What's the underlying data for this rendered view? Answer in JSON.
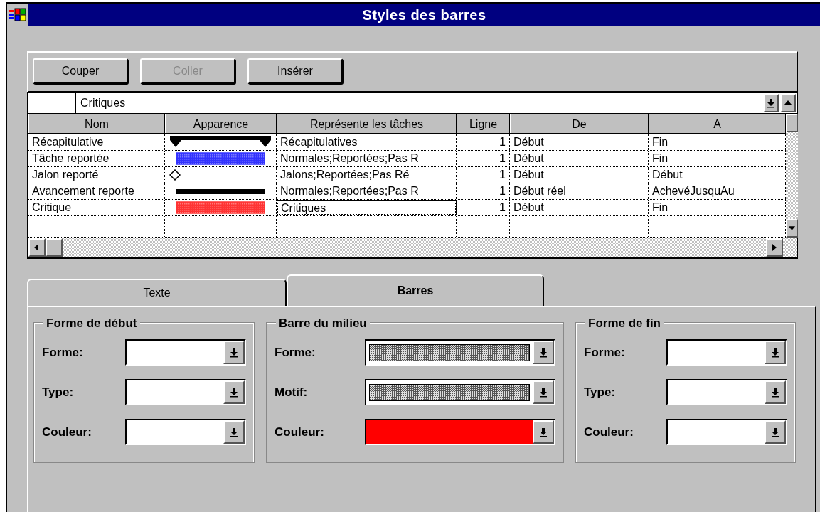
{
  "window": {
    "title": "Styles des barres"
  },
  "toolbar": {
    "buttons": [
      {
        "label": "Couper",
        "disabled": false
      },
      {
        "label": "Coller",
        "disabled": true
      },
      {
        "label": "Insérer",
        "disabled": false
      }
    ]
  },
  "edit_line": {
    "value": "Critiques"
  },
  "table": {
    "columns": [
      "Nom",
      "Apparence",
      "Représente les tâches",
      "Ligne",
      "De",
      "A"
    ],
    "rows": [
      {
        "name": "Récapitulative",
        "appearance": {
          "kind": "summary",
          "color": "#000000"
        },
        "tasks": "Récapitulatives",
        "line": "1",
        "from": "Début",
        "to": "Fin",
        "selected": false
      },
      {
        "name": "Tâche reportée",
        "appearance": {
          "kind": "bar",
          "color": "#3333ff"
        },
        "tasks": "Normales;Reportées;Pas R",
        "line": "1",
        "from": "Début",
        "to": "Fin",
        "selected": false
      },
      {
        "name": "Jalon reporté",
        "appearance": {
          "kind": "diamond",
          "color": "#000000"
        },
        "tasks": "Jalons;Reportées;Pas Ré",
        "line": "1",
        "from": "Début",
        "to": "Début",
        "selected": false
      },
      {
        "name": "Avancement reporte",
        "appearance": {
          "kind": "line",
          "color": "#000000"
        },
        "tasks": "Normales;Reportées;Pas R",
        "line": "1",
        "from": "Début réel",
        "to": "AchevéJusquAu",
        "selected": false
      },
      {
        "name": "Critique",
        "appearance": {
          "kind": "bar",
          "color": "#ff3333"
        },
        "tasks": "Critiques",
        "line": "1",
        "from": "Début",
        "to": "Fin",
        "selected": true
      }
    ]
  },
  "tabs": [
    {
      "label": "Texte",
      "selected": false
    },
    {
      "label": "Barres",
      "selected": true
    }
  ],
  "groups": [
    {
      "title": "Forme de début",
      "fields": [
        {
          "label": "Forme:",
          "kind": "blank"
        },
        {
          "label": "Type:",
          "kind": "blank"
        },
        {
          "label": "Couleur:",
          "kind": "blank"
        }
      ]
    },
    {
      "title": "Barre du milieu",
      "fields": [
        {
          "label": "Forme:",
          "kind": "pattern"
        },
        {
          "label": "Motif:",
          "kind": "pattern"
        },
        {
          "label": "Couleur:",
          "kind": "swatch",
          "color": "#ff0000"
        }
      ]
    },
    {
      "title": "Forme de fin",
      "fields": [
        {
          "label": "Forme:",
          "kind": "blank"
        },
        {
          "label": "Type:",
          "kind": "blank"
        },
        {
          "label": "Couleur:",
          "kind": "blank"
        }
      ]
    }
  ]
}
